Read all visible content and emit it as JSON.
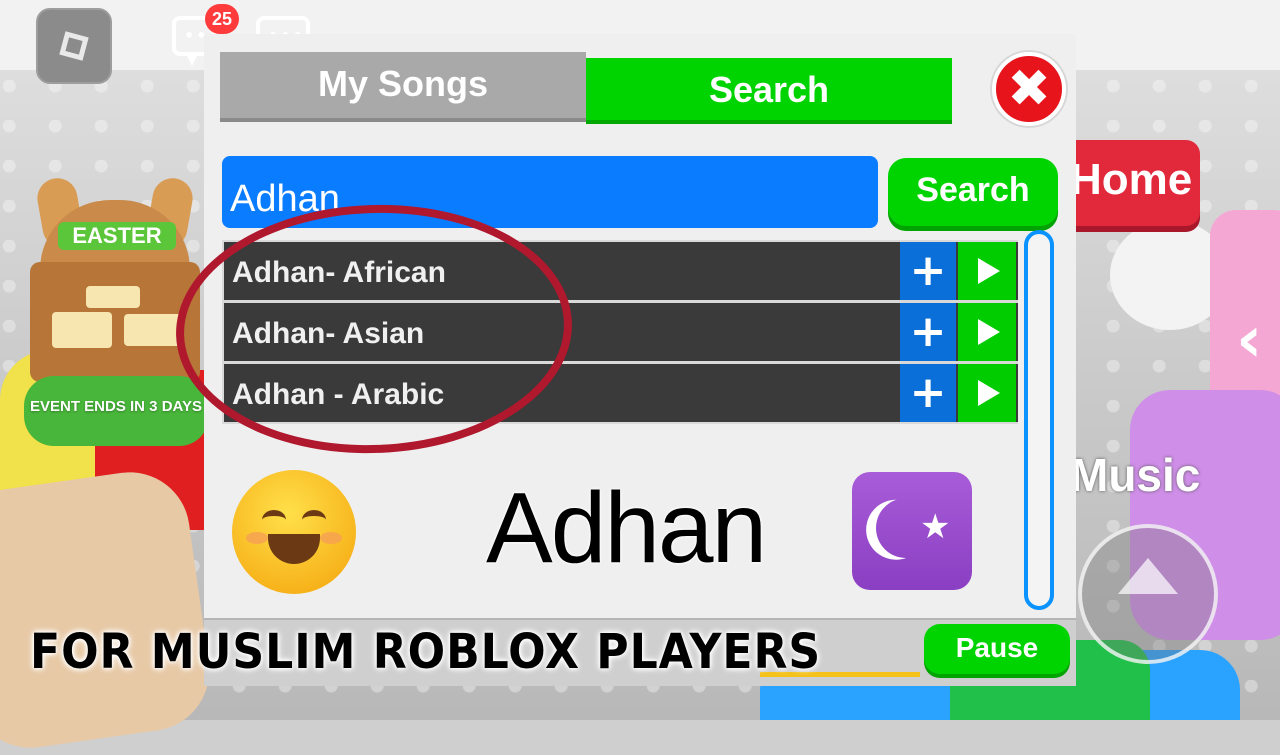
{
  "top_bar": {
    "notification_count": "25",
    "chat_dots": "•••"
  },
  "easter_board": {
    "title": "EASTER",
    "event_ends": "EVENT ENDS IN 3 DAYS"
  },
  "background": {
    "home_label": "Home",
    "music_label": "Music"
  },
  "music_panel": {
    "tabs": [
      {
        "label": "My Songs",
        "active": false
      },
      {
        "label": "Search",
        "active": true
      }
    ],
    "close_symbol": "✖",
    "search_value": "Adhan",
    "search_button": "Search",
    "results": [
      {
        "label": "Adhan- African",
        "add": "+"
      },
      {
        "label": "Adhan- Asian",
        "add": "+"
      },
      {
        "label": "Adhan - Arabic",
        "add": "+"
      }
    ],
    "pause_button": "Pause"
  },
  "overlay": {
    "title": "Adhan",
    "star": "★",
    "caption": "FOR MUSLIM ROBLOX PLAYERS"
  },
  "colors": {
    "tab_active": "#00d400",
    "tab_inactive": "#a9a9a9",
    "search_input": "#0a7cff",
    "close": "#e8141c",
    "row_bg": "#3a3a3a",
    "add_button": "#0a6fd8",
    "play_button": "#00cc00",
    "highlight_ellipse": "#b0182e"
  },
  "icons": [
    "roblox-logo-icon",
    "chat-notification-icon",
    "chat-icon",
    "close-icon",
    "plus-icon",
    "play-icon",
    "smiling-emoji-icon",
    "star-and-crescent-icon",
    "jump-arrow-icon"
  ]
}
